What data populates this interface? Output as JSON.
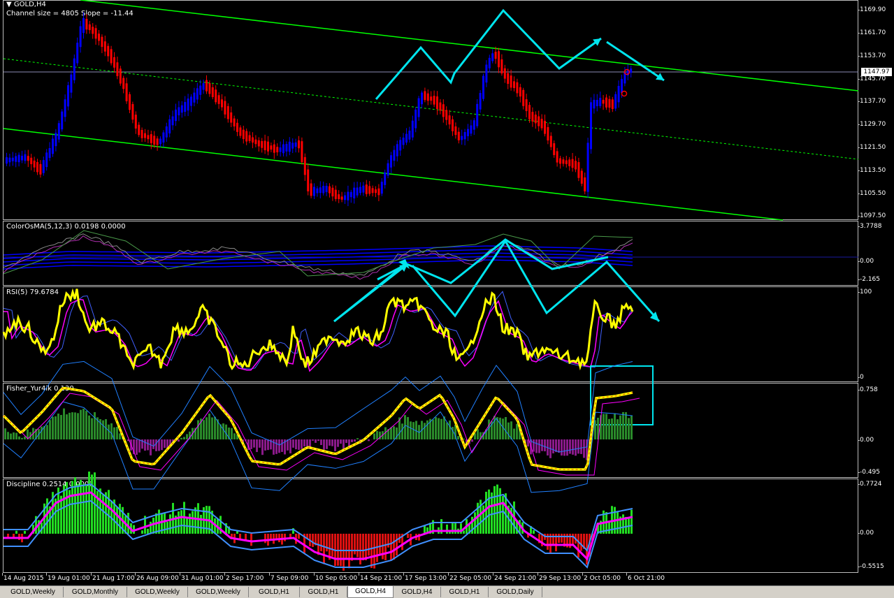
{
  "main": {
    "title": "GOLD,H4",
    "subtitle": "Channel size = 4805 Slope = -11.44",
    "ticks": [
      "1169.90",
      "1161.70",
      "1153.70",
      "1145.70",
      "1137.70",
      "1129.70",
      "1121.50",
      "1113.50",
      "1105.50",
      "1097.50"
    ],
    "current_price": "1147.97"
  },
  "osma": {
    "label": "ColorOsMA(5,12,3) 0.0198 0.0000",
    "ticks": [
      "3.7788",
      "0.00",
      "-2.165"
    ]
  },
  "rsi": {
    "label": "RSI(5) 79.6784",
    "ticks": [
      "100",
      "0"
    ]
  },
  "fisher": {
    "label": "Fisher_Yur4ik 0.130",
    "ticks": [
      "0.758",
      "0.00",
      "-0.495"
    ]
  },
  "discipline": {
    "label": "Discipline 0.2514 0.0000",
    "ticks": [
      "0.7724",
      "0.00",
      "-0.5515"
    ]
  },
  "xaxis": [
    "14 Aug 2015",
    "19 Aug 01:00",
    "21 Aug 17:00",
    "26 Aug 09:00",
    "31 Aug 01:00",
    "2 Sep 17:00",
    "7 Sep 09:00",
    "10 Sep 05:00",
    "14 Sep 21:00",
    "17 Sep 13:00",
    "22 Sep 05:00",
    "24 Sep 21:00",
    "29 Sep 13:00",
    "2 Oct 05:00",
    "6 Oct 21:00"
  ],
  "tabs": [
    "GOLD,Weekly",
    "GOLD,Monthly",
    "GOLD,Weekly",
    "GOLD,Weekly",
    "GOLD,H1",
    "GOLD,H1",
    "GOLD,H4",
    "GOLD,H4",
    "GOLD,H1",
    "GOLD,Daily"
  ],
  "active_tab": 6,
  "colors": {
    "bull": "#0000ff",
    "bear": "#ff0000",
    "channel": "#00ff00",
    "annotation": "#00e5ee",
    "rsi": "#ffff00",
    "signal": "#ff00ff"
  }
}
